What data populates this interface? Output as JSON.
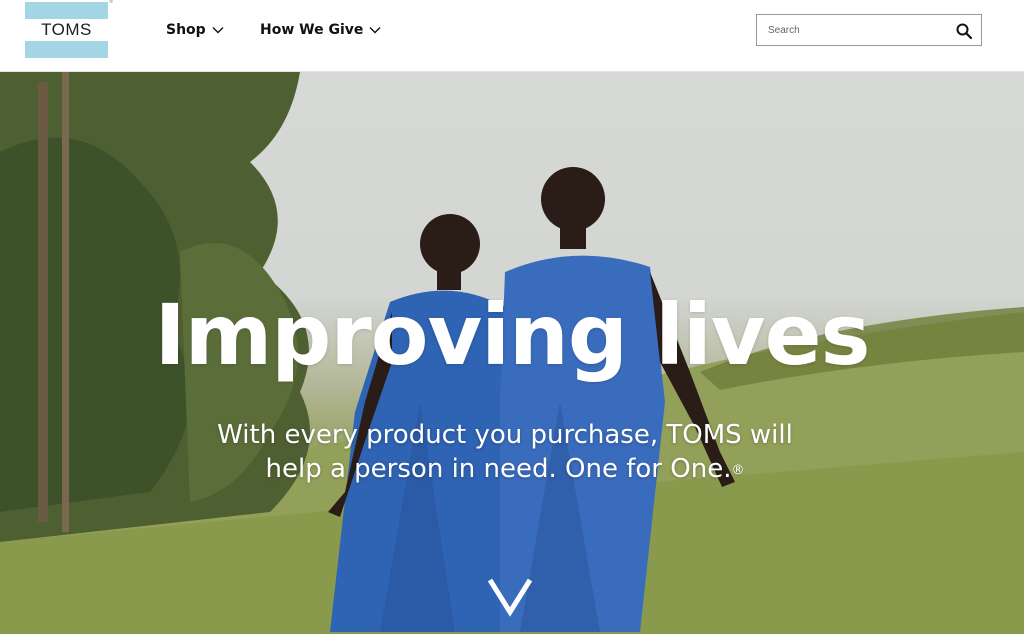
{
  "header": {
    "logo_text": "TOMS",
    "logo_reg": "®",
    "nav": [
      {
        "label": "Shop"
      },
      {
        "label": "How We Give"
      }
    ],
    "search": {
      "placeholder": "Search",
      "value": ""
    }
  },
  "hero": {
    "title": "Improving lives",
    "subtitle_line1": "With every product you purchase, TOMS will",
    "subtitle_line2": "help a person in need. One for One.",
    "subtitle_reg": "®"
  },
  "colors": {
    "logo_band": "#a4d5e5",
    "uniform_blue": "#2f63b3",
    "grass": "#8f9c55"
  },
  "icons": {
    "search": "search-icon",
    "nav_chevron": "chevron-down-icon",
    "scroll": "chevron-down-icon"
  }
}
